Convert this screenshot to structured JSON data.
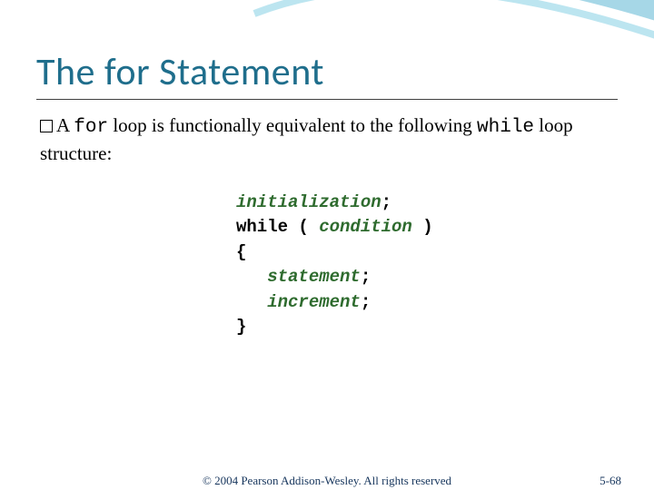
{
  "title": "The for Statement",
  "body": {
    "prefix": "A ",
    "code1": "for",
    "mid1": " loop is functionally equivalent to the following ",
    "code2": "while",
    "suffix": " loop structure:"
  },
  "code": {
    "l1": "initialization",
    "l1_tail": ";",
    "l2_kw": "while ( ",
    "l2_cond": "condition",
    "l2_tail": " )",
    "l3": "{",
    "l4_indent": "   ",
    "l4": "statement",
    "l4_tail": ";",
    "l5_indent": "   ",
    "l5": "increment",
    "l5_tail": ";",
    "l6": "}"
  },
  "footer": {
    "copyright": "© 2004 Pearson Addison-Wesley. All rights reserved",
    "page": "5-68"
  },
  "colors": {
    "title": "#1f6e8c",
    "code_italic": "#2e6b2e",
    "footer": "#17365d"
  }
}
